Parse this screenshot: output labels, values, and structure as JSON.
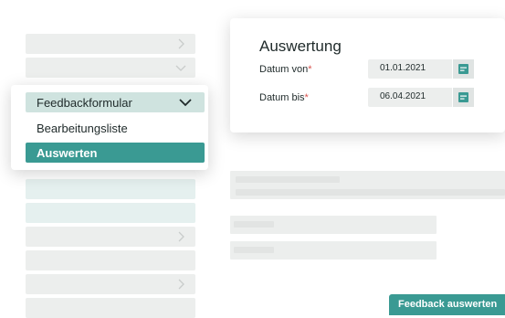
{
  "dropdown": {
    "selected_label": "Feedbackformular",
    "items": [
      {
        "label": "Bearbeitungsliste",
        "active": false
      },
      {
        "label": "Auswerten",
        "active": true
      }
    ]
  },
  "evaluation": {
    "title": "Auswertung",
    "date_from": {
      "label": "Datum von",
      "required_mark": "*",
      "value": "01.01.2021"
    },
    "date_to": {
      "label": "Datum bis",
      "required_mark": "*",
      "value": "06.04.2021"
    }
  },
  "footer": {
    "feedback_button": "Feedback auswerten"
  },
  "colors": {
    "accent": "#3a9a93",
    "selected_tint": "#cfe3df",
    "placeholder": "#eceeed",
    "required": "#d9534f"
  },
  "icons": {
    "row_chevron": "chevron-right-icon",
    "dropdown_chevron": "chevron-down-icon",
    "date_picker": "calendar-icon"
  }
}
